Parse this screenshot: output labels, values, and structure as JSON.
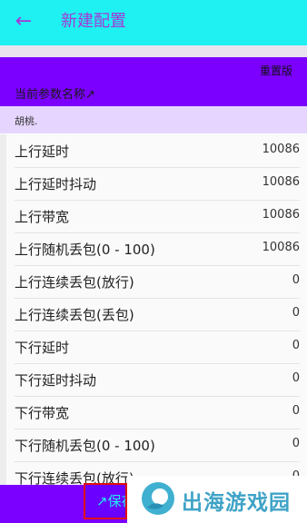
{
  "app_bar": {
    "title": "新建配置",
    "back_icon": "arrow-left-icon"
  },
  "param": {
    "reset_label": "重置版",
    "name_label": "当前参数名称↗"
  },
  "profile_name": "胡桃.",
  "rows": [
    {
      "label": "上行延时",
      "value": "10086"
    },
    {
      "label": "上行延时抖动",
      "value": "10086"
    },
    {
      "label": "上行带宽",
      "value": "10086"
    },
    {
      "label": "上行随机丢包(0 - 100)",
      "value": "10086"
    },
    {
      "label": "上行连续丢包(放行)",
      "value": "0"
    },
    {
      "label": "上行连续丢包(丢包)",
      "value": "0"
    },
    {
      "label": "下行延时",
      "value": "0"
    },
    {
      "label": "下行延时抖动",
      "value": "0"
    },
    {
      "label": "下行带宽",
      "value": "0"
    },
    {
      "label": "下行随机丢包(0 - 100)",
      "value": "0"
    },
    {
      "label": "下行连续丢包(放行)",
      "value": "0"
    }
  ],
  "save_label": "↗保存",
  "watermark": {
    "text": "出海游戏园",
    "logo_icon": "site-logo-icon"
  },
  "colors": {
    "accent": "#1ff0f2",
    "primary": "#7b00ff",
    "title": "#a13ad6"
  }
}
